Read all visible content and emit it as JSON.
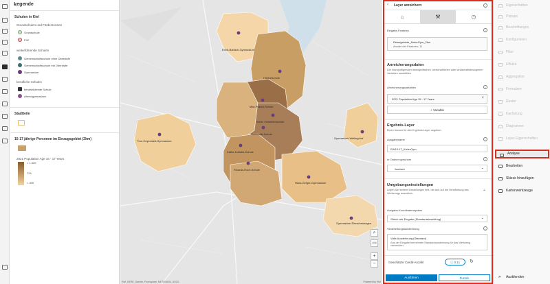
{
  "legend": {
    "title": "Legende",
    "section1": "Schulen in Kiel",
    "grund_header": "Grundschulen und Förderzentren",
    "grund_items": [
      "Grundschule",
      "FöZ"
    ],
    "weiter_header": "weiterführende Schulen",
    "weiter_items": [
      "Gemeinschaftsschule ohne Oberstufe",
      "Gemeinschaftsschule mit Oberstufe",
      "Gymnasium"
    ],
    "beruf_header": "berufliche Schulen",
    "beruf_items": [
      "berufsbildende Schule",
      "Abendgymnasium"
    ],
    "stadtteile": "Stadtteile",
    "pop_title": "15-17 jährige Personen im Einzugsgebiet (2km)",
    "pop_sub": "2021 Population Age 15 - 17 Years",
    "pop_ticks": [
      "> 1.029",
      "724",
      "< 400"
    ]
  },
  "map": {
    "labels": [
      "Ernst-Barlach-Gymnasium",
      "Hebbelschule",
      "Max-Planck-Schule",
      "Kieler Gelehrtenschule",
      "Humboldt-Schule",
      "Thor-Heyerdahl-Gymnasium",
      "Käthe-Kollwitz-Schule",
      "Ricarda-Huch-Schule",
      "Hans-Geiger-Gymnasium",
      "Gymnasium Elmschenhagen",
      "Gymnasium Wellingdorf"
    ],
    "attribution": "Esri, HERE, Garmin, Foursquare, METI/NASA, USGS",
    "powered": "Powered by Esri"
  },
  "panel": {
    "title": "Layer anreichern",
    "input_label": "Eingabe-Features",
    "input_name": "Reisegebiete_KielerGym_2km",
    "input_count": "Anzahl der Features: 11",
    "enrich_title": "Anreicherungsdaten",
    "enrich_desc": "Die hinzuzufügenden demografischen, wirtschaftlichen oder landschaftsbezogenen Variablen auswählen.",
    "vars_label": "Anreicherungsvariablen",
    "var_value": "2021 Population Age 15 - 17 Years",
    "add_var": "Variable",
    "result_title": "Ergebnis-Layer",
    "result_desc": "Einen Namen für den Ergebnis-Layer angeben.",
    "output_label": "Ausgabename",
    "output_value": "EW15-17_KielerGym",
    "folder_label": "In Ordner speichern",
    "folder_value": "ilmefach",
    "env_title": "Umgebungseinstellungen",
    "env_desc": "Legen Sie weitere Einstellungen fest, die sich auf die Verarbeitung des Werkzeugs auswirken.",
    "coord_label": "Ausgabe-Koordinatensystem",
    "coord_value": "Gleich wie Eingabe (Standardeinstellung)",
    "extent_label": "Verarbeitungsausdehnung",
    "extent_value": "Volle Ausdehnung (Standard)",
    "extent_desc": "Aus der Eingabe berechnete Standardausdehnung für das Werkzeug verwenden.",
    "credits_label": "Geschätzte Credit-Anzahl",
    "credits_value": "0.11",
    "run": "Ausführen",
    "back": "Zurück"
  },
  "rail": {
    "items": [
      "Eigenschaften",
      "Popups",
      "Beschriftungen",
      "Konfigurieren",
      "Filter",
      "Effekte",
      "Aggregation",
      "Formulare",
      "Raster",
      "Kachelung",
      "Diagramme",
      "Layer-Eigenschaften",
      "Analyse",
      "Bearbeiten",
      "Skizze hinzufügen",
      "Kartenwerkzeuge"
    ],
    "collapse": "Ausblenden"
  }
}
